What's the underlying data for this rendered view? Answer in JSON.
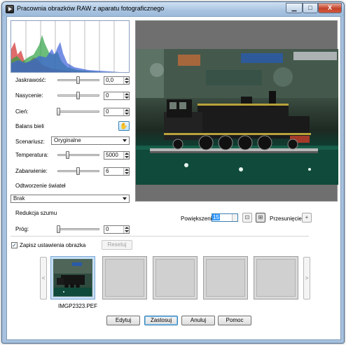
{
  "window": {
    "title": "Pracownia obrazków RAW z aparatu fotograficznego",
    "controls": {
      "minimize": "▁",
      "maximize": "□",
      "close": "X"
    }
  },
  "adjustments": {
    "jaskrawosc": {
      "label": "Jaskrawość:",
      "value": "0,0"
    },
    "nasycenie": {
      "label": "Nasycenie:",
      "value": "0"
    },
    "cien": {
      "label": "Cień:",
      "value": "0"
    }
  },
  "white_balance": {
    "heading": "Balans bieli",
    "scenario_label": "Scenariusz:",
    "scenario_value": "Oryginalne",
    "temperature_label": "Temperatura:",
    "temperature_value": "5000",
    "tint_label": "Zabarwienie:",
    "tint_value": "6"
  },
  "light_recovery": {
    "heading": "Odtworzenie świateł",
    "value": "Brak"
  },
  "noise": {
    "heading": "Redukcja szumu",
    "threshold_label": "Próg:",
    "threshold_value": "0"
  },
  "zoom": {
    "label": "Powiększenie:",
    "value": "15",
    "pan_label": "Przesunięcie:"
  },
  "save_settings": {
    "label": "Zapisz ustawienia obrazka",
    "checked": true,
    "reset_label": "Resetuj"
  },
  "filmstrip": {
    "prev": "<",
    "next": ">",
    "items": [
      {
        "name": "IMGP2323.PEF",
        "selected": true
      },
      {
        "name": ""
      },
      {
        "name": ""
      },
      {
        "name": ""
      },
      {
        "name": ""
      }
    ]
  },
  "buttons": {
    "edit": "Edytuj",
    "apply": "Zastosuj",
    "cancel": "Anuluj",
    "help": "Pomoc"
  },
  "colors": {
    "window_frame": "#a7c1de",
    "accent": "#3399ff",
    "histogram_red": "#d43a3a",
    "histogram_green": "#2ea043",
    "histogram_blue": "#3a5fd8"
  }
}
